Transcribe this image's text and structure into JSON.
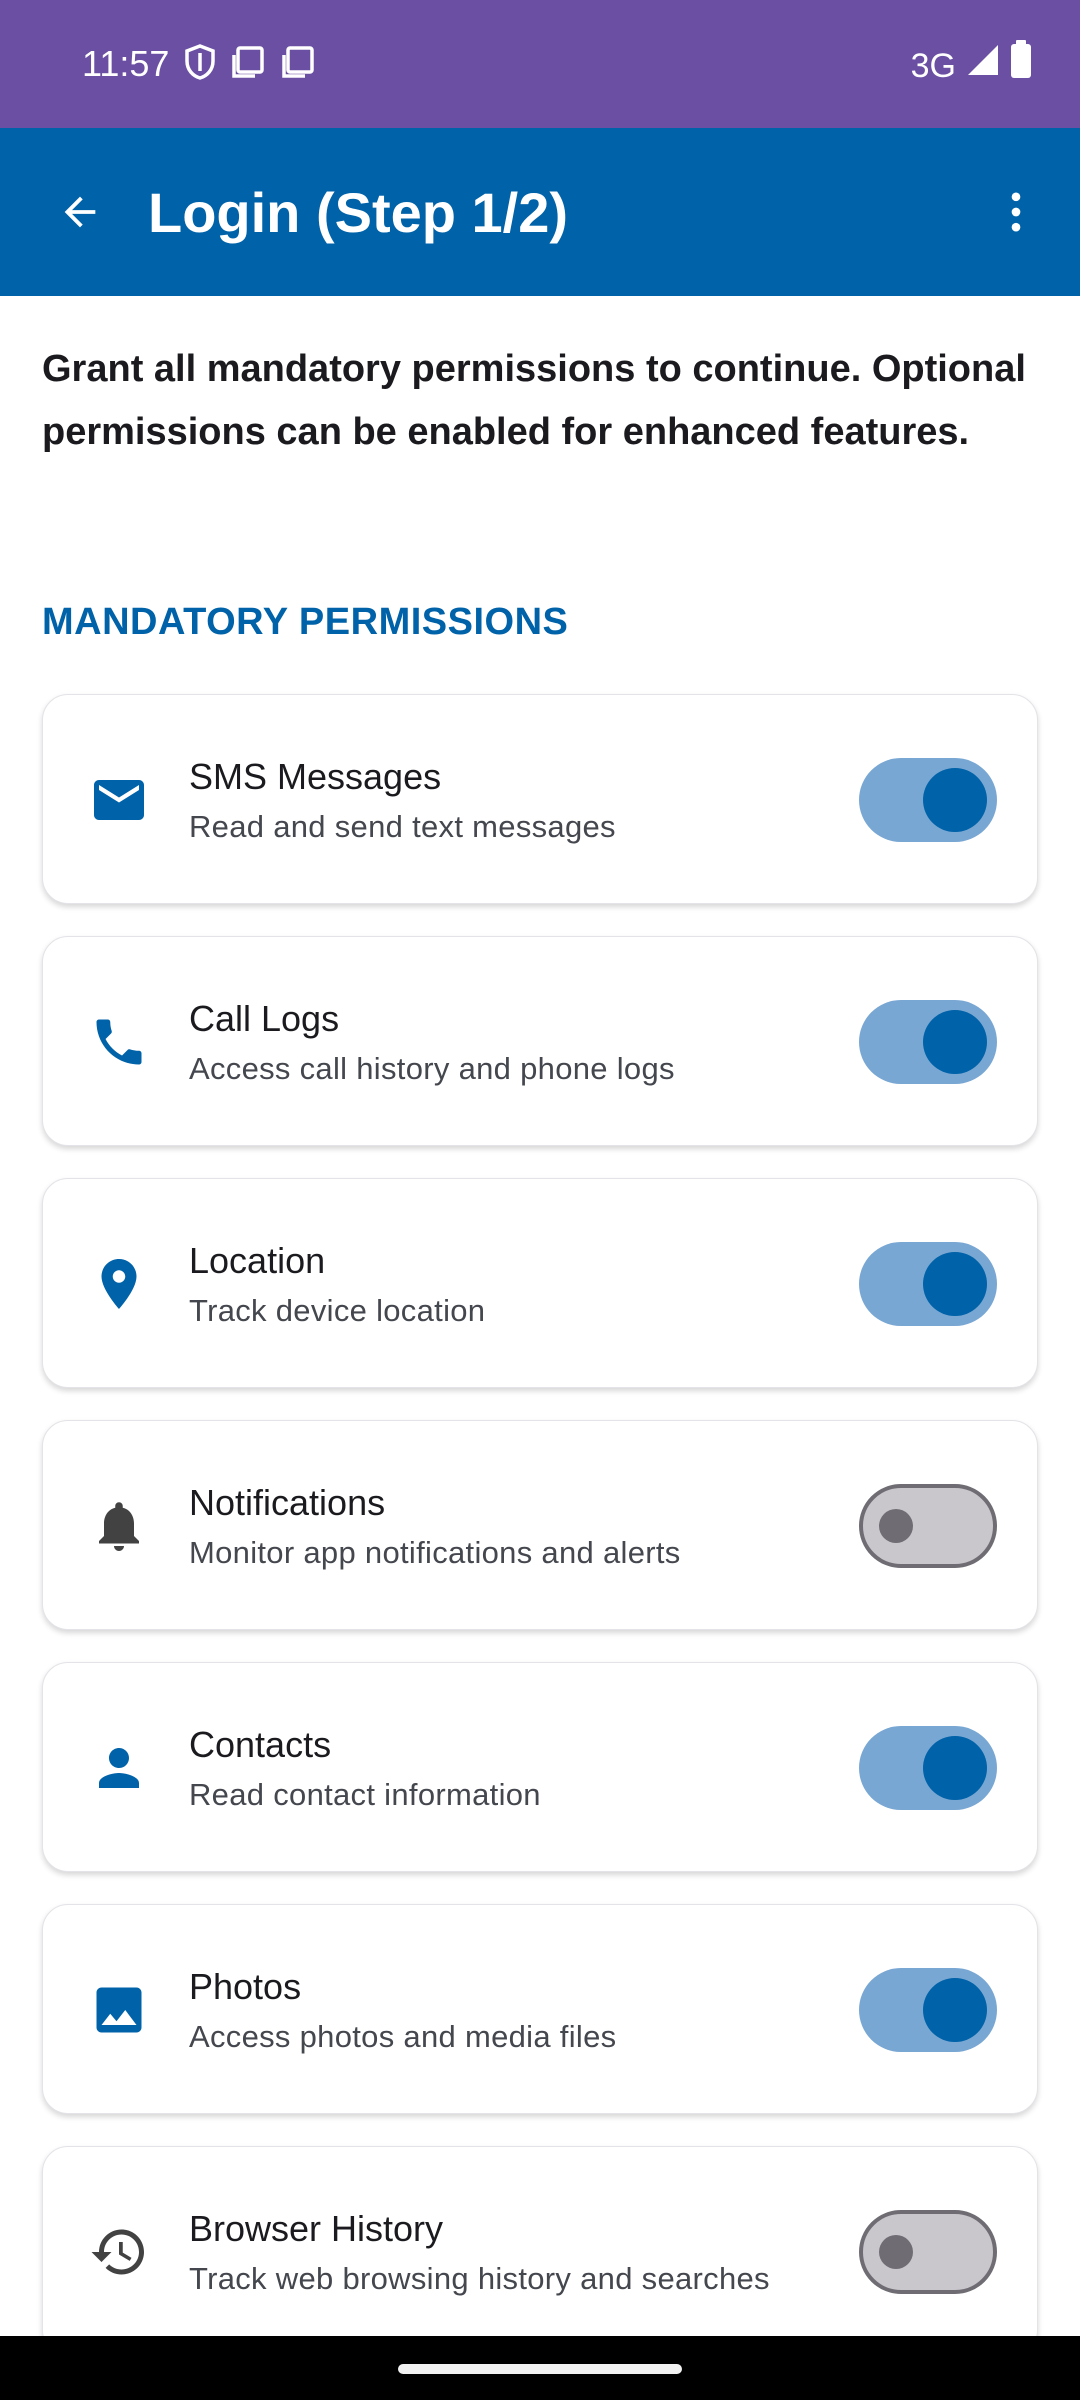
{
  "status_bar": {
    "time": "11:57",
    "network": "3G",
    "left_icons": [
      "shield-icon",
      "sim-card-icon",
      "sim-card-icon"
    ],
    "right_icons": [
      "signal-icon",
      "battery-icon"
    ]
  },
  "app_bar": {
    "title": "Login (Step 1/2)",
    "back_icon": "arrow-back-icon",
    "menu_icon": "more-vert-icon",
    "background": "#0062a8"
  },
  "intro_text": "Grant all mandatory permissions to continue. Optional permissions can be enabled for enhanced features.",
  "section_title": "MANDATORY PERMISSIONS",
  "colors": {
    "accent": "#0062a8",
    "status_bar": "#6a4fa3",
    "toggle_on_track": "#79a7d3",
    "toggle_off_track": "#c9c6cc"
  },
  "permissions": [
    {
      "title": "SMS Messages",
      "description": "Read and send text messages",
      "icon": "email-icon",
      "enabled": true
    },
    {
      "title": "Call Logs",
      "description": "Access call history and phone logs",
      "icon": "phone-icon",
      "enabled": true
    },
    {
      "title": "Location",
      "description": "Track device location",
      "icon": "location-pin-icon",
      "enabled": true
    },
    {
      "title": "Notifications",
      "description": "Monitor app notifications and alerts",
      "icon": "bell-icon",
      "enabled": false
    },
    {
      "title": "Contacts",
      "description": "Read contact information",
      "icon": "person-icon",
      "enabled": true
    },
    {
      "title": "Photos",
      "description": "Access photos and media files",
      "icon": "image-icon",
      "enabled": true
    },
    {
      "title": "Browser History",
      "description": "Track web browsing history and searches",
      "icon": "history-icon",
      "enabled": false
    }
  ]
}
